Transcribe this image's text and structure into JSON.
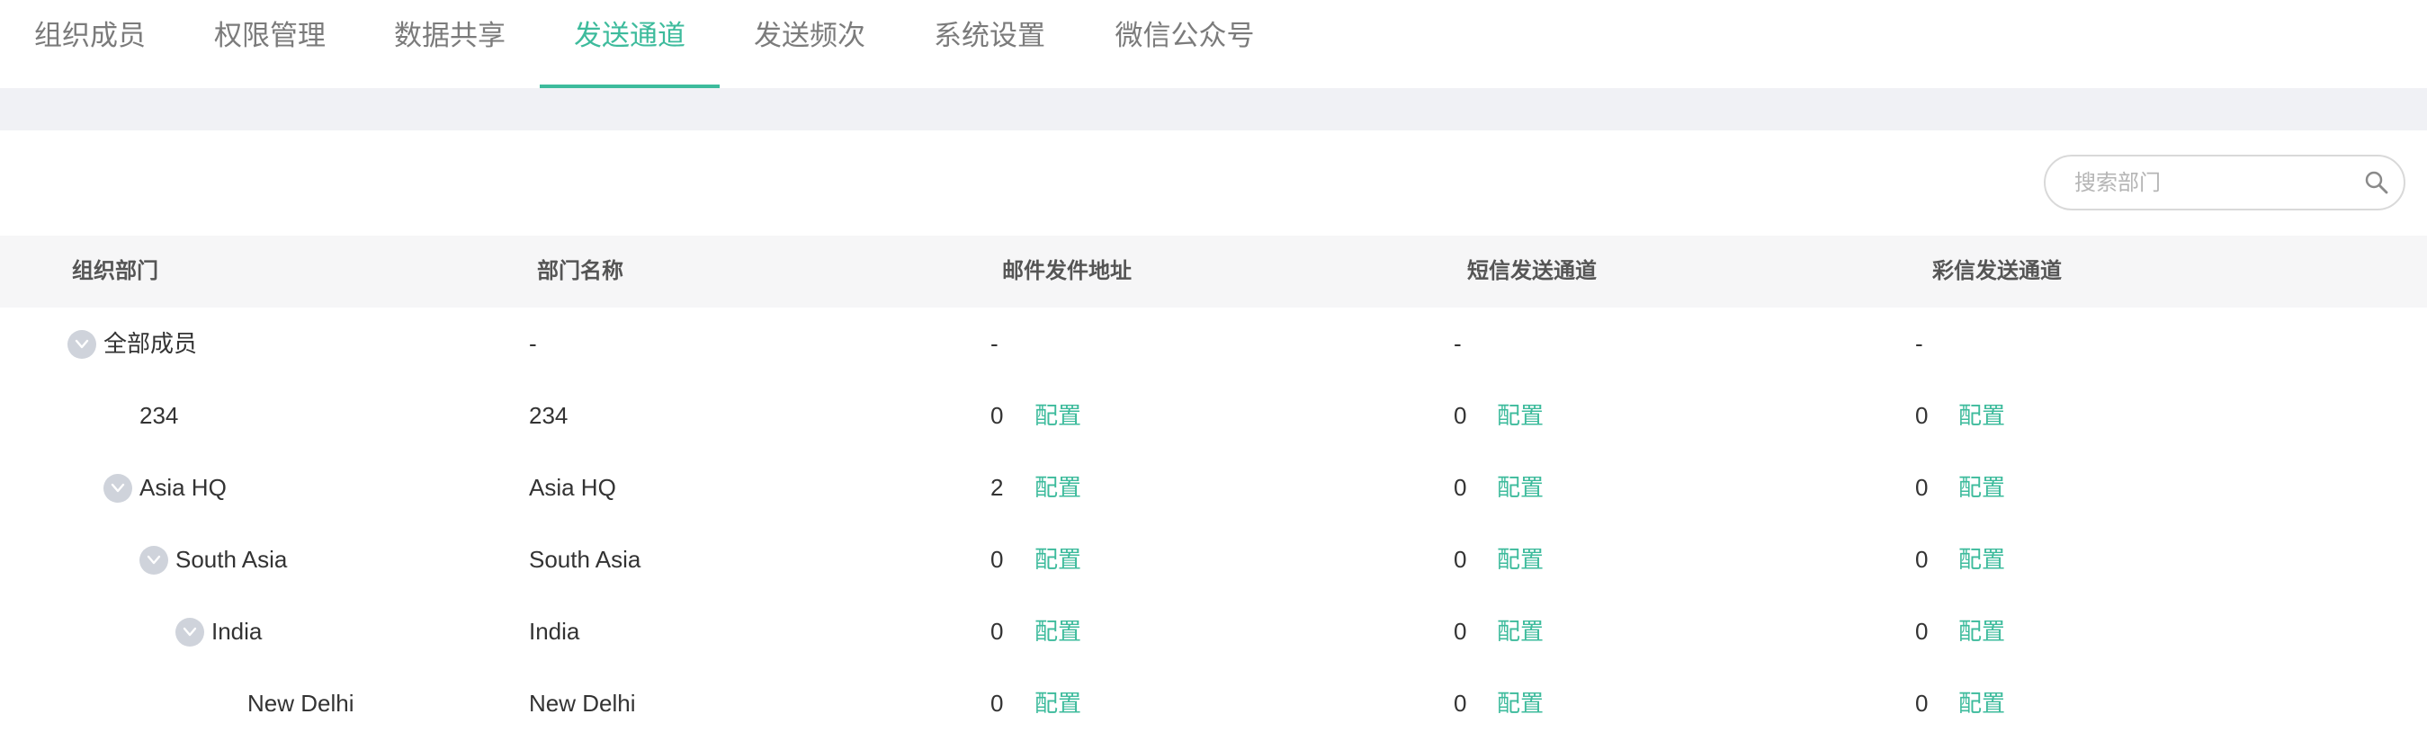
{
  "tabs": [
    {
      "label": "组织成员",
      "active": false
    },
    {
      "label": "权限管理",
      "active": false
    },
    {
      "label": "数据共享",
      "active": false
    },
    {
      "label": "发送通道",
      "active": true
    },
    {
      "label": "发送频次",
      "active": false
    },
    {
      "label": "系统设置",
      "active": false
    },
    {
      "label": "微信公众号",
      "active": false
    }
  ],
  "search": {
    "placeholder": "搜索部门"
  },
  "table": {
    "headers": [
      "组织部门",
      "部门名称",
      "邮件发件地址",
      "短信发送通道",
      "彩信发送通道"
    ],
    "config_label": "配置",
    "rows": [
      {
        "tree_label": "全部成员",
        "expandable": true,
        "level": 0,
        "name": "-",
        "email": "-",
        "sms": "-",
        "mms": "-",
        "configurable": false
      },
      {
        "tree_label": "234",
        "expandable": false,
        "level": 1,
        "name": "234",
        "email": "0",
        "sms": "0",
        "mms": "0",
        "configurable": true
      },
      {
        "tree_label": "Asia HQ",
        "expandable": true,
        "level": 1,
        "name": "Asia HQ",
        "email": "2",
        "sms": "0",
        "mms": "0",
        "configurable": true
      },
      {
        "tree_label": "South Asia",
        "expandable": true,
        "level": 2,
        "name": "South Asia",
        "email": "0",
        "sms": "0",
        "mms": "0",
        "configurable": true
      },
      {
        "tree_label": "India",
        "expandable": true,
        "level": 3,
        "name": "India",
        "email": "0",
        "sms": "0",
        "mms": "0",
        "configurable": true
      },
      {
        "tree_label": "New Delhi",
        "expandable": false,
        "level": 4,
        "name": "New Delhi",
        "email": "0",
        "sms": "0",
        "mms": "0",
        "configurable": true
      }
    ]
  },
  "colors": {
    "accent": "#3dbb9c",
    "band": "#f0f1f5",
    "header_bg": "#f6f6f7"
  },
  "icons": {
    "search": "search-icon",
    "collapse": "chevron-down-icon"
  }
}
